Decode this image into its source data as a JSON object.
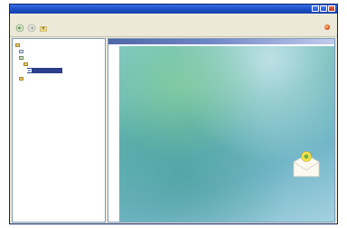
{
  "window": {
    "title": "",
    "menu": [
      "",
      "",
      "",
      "",
      "",
      ""
    ]
  },
  "toolbar": {
    "brand_text": ""
  },
  "tree": {
    "items": [
      "",
      "",
      "",
      "",
      "",
      ""
    ]
  },
  "preview": {
    "header": ""
  },
  "colors": {
    "titlebar": "#1b4fc4",
    "selection": "#2b3e8c",
    "pane_header": "#4f66a8",
    "brand": "#b02a0a"
  },
  "icons": [
    "back-arrow-icon",
    "forward-arrow-icon",
    "up-folder-icon",
    "brand-logo-icon",
    "folder-icon",
    "envelope-icon"
  ]
}
